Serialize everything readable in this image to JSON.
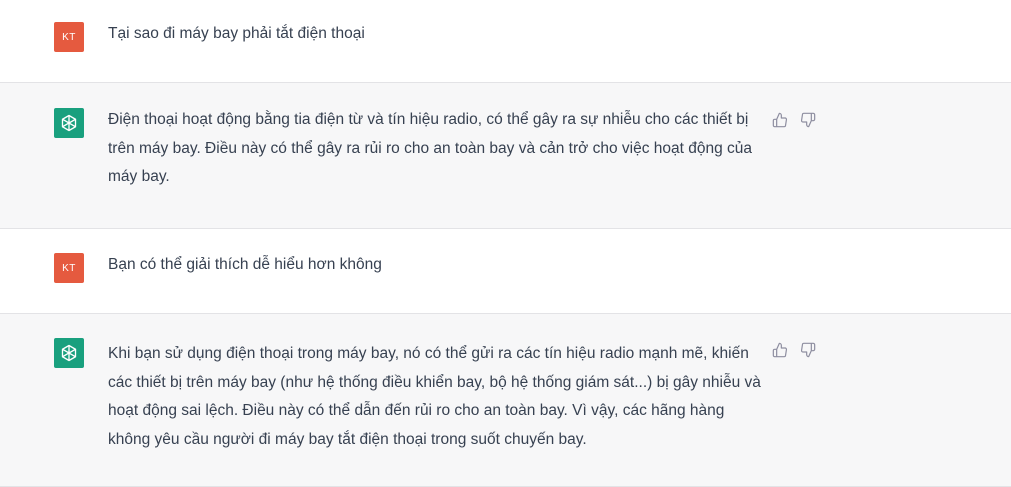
{
  "conversation": {
    "messages": [
      {
        "role": "user",
        "avatar_initials": "KT",
        "text": "Tại sao đi máy bay phải tắt điện thoại"
      },
      {
        "role": "assistant",
        "avatar_icon": "openai-logo-icon",
        "text": "Điện thoại hoạt động bằng tia điện từ và tín hiệu radio, có thể gây ra sự nhiễu cho các thiết bị trên máy bay. Điều này có thể gây ra rủi ro cho an toàn bay và cản trở cho việc hoạt động của máy bay."
      },
      {
        "role": "user",
        "avatar_initials": "KT",
        "text": "Bạn có thể giải thích dễ hiểu hơn không"
      },
      {
        "role": "assistant",
        "avatar_icon": "openai-logo-icon",
        "text": "Khi bạn sử dụng điện thoại trong máy bay, nó có thể gửi ra các tín hiệu radio mạnh mẽ, khiến các thiết bị trên máy bay (như hệ thống điều khiển bay, bộ hệ thống giám sát...) bị gây nhiễu và hoạt động sai lệch. Điều này có thể dẫn đến rủi ro cho an toàn bay. Vì vậy, các hãng hàng không yêu cầu người đi máy bay tắt điện thoại trong suốt chuyến bay."
      }
    ],
    "feedback_icons": [
      "thumbs-up-icon",
      "thumbs-down-icon"
    ]
  },
  "colors": {
    "user_avatar_bg": "#e55a3f",
    "assistant_avatar_bg": "#19a07e",
    "assistant_row_bg": "#f7f7f8",
    "text": "#374151"
  }
}
